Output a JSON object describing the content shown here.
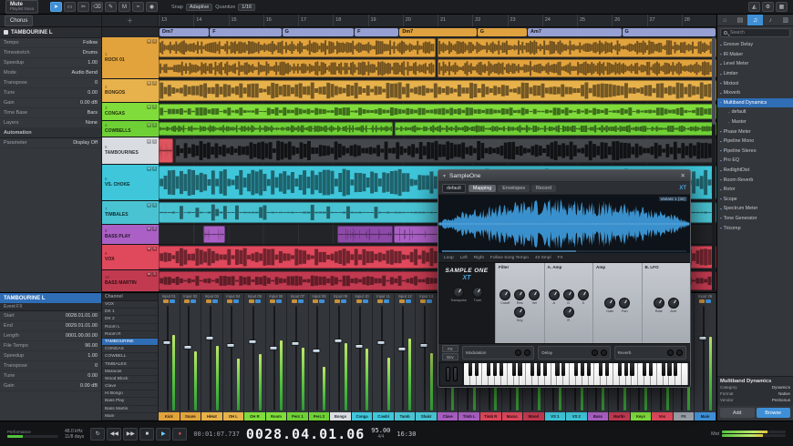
{
  "topbar": {
    "mute": "Mute",
    "playlist": "Playlist Nova",
    "tools": [
      {
        "n": "arrow-tool",
        "g": "➤"
      },
      {
        "n": "range-tool",
        "g": "▭"
      },
      {
        "n": "split-tool",
        "g": "✂"
      },
      {
        "n": "erase-tool",
        "g": "⌫"
      },
      {
        "n": "paint-tool",
        "g": "✎"
      },
      {
        "n": "mute-tool",
        "g": "M"
      },
      {
        "n": "bend-tool",
        "g": "≈"
      },
      {
        "n": "listen-tool",
        "g": "◉"
      }
    ],
    "snap_label": "Snap",
    "snap_mode": "Adaptive",
    "quantize_label": "Quantize",
    "quantize_value": "1/16",
    "right_icons": [
      {
        "n": "metronome-icon",
        "g": "◭"
      },
      {
        "n": "settings-icon",
        "g": "⚙"
      },
      {
        "n": "grid-icon",
        "g": "▦"
      }
    ]
  },
  "arrangetab": {
    "label": "Chorus"
  },
  "ruler": {
    "start": 13,
    "count": 16
  },
  "chords": [
    {
      "label": "Dm7",
      "w": 9,
      "c": "#97a0d2"
    },
    {
      "label": "F",
      "w": 13,
      "c": "#97a0d2"
    },
    {
      "label": "G",
      "w": 13,
      "c": "#97a0d2"
    },
    {
      "label": "F",
      "w": 8,
      "c": "#97a0d2"
    },
    {
      "label": "Dm7",
      "w": 14,
      "c": "#dfa23f"
    },
    {
      "label": "G",
      "w": 9,
      "c": "#dfa23f"
    },
    {
      "label": "Am7",
      "w": 17,
      "c": "#97a0d2"
    },
    {
      "label": "G",
      "w": 17,
      "c": "#97a0d2"
    }
  ],
  "tracks": [
    {
      "num": "1",
      "name": "ROCK 01",
      "color": "#e2a33c",
      "h": 46,
      "lanes": [
        [
          {
            "x": 0,
            "w": 49.6,
            "wave": "dense"
          },
          {
            "x": 50,
            "w": 50,
            "wave": "dense"
          }
        ],
        [
          {
            "x": 0,
            "w": 49.6,
            "wave": "dense"
          },
          {
            "x": 50,
            "w": 50,
            "wave": "dense"
          }
        ]
      ]
    },
    {
      "num": "2",
      "name": "BONGOS",
      "color": "#e7b14b",
      "h": 26,
      "lanes": [
        [
          {
            "x": 0,
            "w": 100,
            "wave": "dense"
          }
        ]
      ]
    },
    {
      "num": "3",
      "name": "CONGAS",
      "color": "#7fdc3a",
      "h": 20,
      "lanes": [
        [
          {
            "x": 0,
            "w": 100,
            "wave": "med"
          }
        ]
      ]
    },
    {
      "num": "4",
      "name": "COWBELLS",
      "color": "#6fd036",
      "h": 18,
      "lanes": [
        [
          {
            "x": 0,
            "w": 42,
            "wave": "med"
          },
          {
            "x": 42.4,
            "w": 57.6,
            "wave": "med"
          }
        ]
      ]
    },
    {
      "num": "5",
      "name": "TAMBOURINES",
      "color": "#d9dde2",
      "h": 30,
      "lanes": [
        [
          {
            "x": 0,
            "w": 2.6,
            "wave": "sparse",
            "color": "#e05560"
          },
          {
            "x": 2.9,
            "w": 97.1,
            "wave": "dense",
            "color": "#44474b",
            "stroke": "rgba(8,10,12,0.85)"
          }
        ]
      ]
    },
    {
      "num": "6",
      "name": "VS. CHOKE",
      "color": "#3fc6da",
      "h": 40,
      "lanes": [
        [
          {
            "x": 0,
            "w": 100,
            "wave": "dense"
          }
        ]
      ]
    },
    {
      "num": "7",
      "name": "TIMBALES",
      "color": "#49c3d2",
      "h": 26,
      "lanes": [
        [
          {
            "x": 0,
            "w": 100,
            "wave": "sparse"
          }
        ]
      ]
    },
    {
      "num": "8",
      "name": "BASS PLAY",
      "color": "#aa60c4",
      "h": 22,
      "lanes": [
        [
          {
            "x": 8,
            "w": 4,
            "wave": "sparse"
          },
          {
            "x": 32,
            "w": 10,
            "wave": "sparse",
            "color": "#8e4aa8"
          },
          {
            "x": 42.2,
            "w": 13,
            "wave": "sparse"
          },
          {
            "x": 55.5,
            "w": 2.6,
            "wave": "sparse"
          }
        ]
      ]
    },
    {
      "num": "9",
      "name": "VOX",
      "color": "#e0485c",
      "h": 28,
      "lanes": [
        [
          {
            "x": 0,
            "w": 100,
            "wave": "dense"
          }
        ]
      ]
    },
    {
      "num": "10",
      "name": "BASS MARTIN",
      "color": "#c23a50",
      "h": 24,
      "lanes": [
        [
          {
            "x": 0,
            "w": 100,
            "wave": "med"
          }
        ]
      ]
    }
  ],
  "inspector": {
    "title": "TAMBOURINE L",
    "rows": [
      [
        "Tempo",
        "Follow"
      ],
      [
        "Timestretch",
        "Drums"
      ],
      [
        "Speedup",
        "1.00"
      ],
      [
        "Mode",
        "Audio Bend"
      ],
      [
        "Transpose",
        "0"
      ],
      [
        "Tune",
        "0.00"
      ],
      [
        "Gain",
        "0.00 dB"
      ],
      [
        "Time Base",
        "Bars"
      ],
      [
        "Layers",
        "None"
      ]
    ],
    "automation_label": "Automation",
    "auto_rows": [
      [
        "Parameter",
        "Display Off"
      ]
    ]
  },
  "eventpanel": {
    "title": "TAMBOURINE L",
    "subtitle": "Event FX",
    "rows": [
      [
        "Start",
        "0028.01.01.00"
      ],
      [
        "End",
        "0029.01.01.00"
      ],
      [
        "Length",
        "0001.00.00.00"
      ],
      [
        "File Tempo",
        "96.00"
      ],
      [
        "Speedup",
        "1.00"
      ],
      [
        "Transpose",
        "0"
      ],
      [
        "Tune",
        "0.00"
      ],
      [
        "Gain",
        "0.00 dB"
      ]
    ]
  },
  "mixer": {
    "channel_header": "Channel",
    "left_list": [
      "VOX",
      "DK 1",
      "DK 2",
      "Room L",
      "Room R",
      "TAMBOURINE",
      "CONGAS",
      "COWBELL",
      "TIMBALES",
      "Maracas",
      "Wood Block",
      "Clave",
      "Hi Bongo",
      "Bass Play",
      "Bass Martin",
      "Main"
    ],
    "highlight": "TAMBOURINE",
    "strips": [
      {
        "label": "Input 01",
        "level": 62,
        "meter": 70,
        "tag": "Kick",
        "color": "#e2a33c"
      },
      {
        "label": "Input 02",
        "level": 58,
        "meter": 55,
        "tag": "Snare",
        "color": "#e2a33c"
      },
      {
        "label": "Input 03",
        "level": 66,
        "meter": 60,
        "tag": "HiHat",
        "color": "#e7b14b"
      },
      {
        "label": "Input 04",
        "level": 60,
        "meter": 48,
        "tag": "OH L",
        "color": "#e7b14b"
      },
      {
        "label": "Input 05",
        "level": 63,
        "meter": 52,
        "tag": "OH R",
        "color": "#7fdc3a"
      },
      {
        "label": "Input 06",
        "level": 57,
        "meter": 65,
        "tag": "Room",
        "color": "#7fdc3a"
      },
      {
        "label": "Input 07",
        "level": 61,
        "meter": 58,
        "tag": "Perc 1",
        "color": "#6fd036"
      },
      {
        "label": "Input 08",
        "level": 55,
        "meter": 40,
        "tag": "Perc 2",
        "color": "#6fd036"
      },
      {
        "label": "Input 09",
        "level": 64,
        "meter": 62,
        "tag": "Bongo",
        "color": "#d9dde2"
      },
      {
        "label": "Input 10",
        "level": 59,
        "meter": 57,
        "tag": "Conga",
        "color": "#3fc6da"
      },
      {
        "label": "Input 11",
        "level": 62,
        "meter": 49,
        "tag": "Cowbl",
        "color": "#3fc6da"
      },
      {
        "label": "Input 12",
        "level": 56,
        "meter": 66,
        "tag": "Tamb",
        "color": "#49c3d2"
      },
      {
        "label": "Input 13",
        "level": 60,
        "meter": 53,
        "tag": "Shakr",
        "color": "#49c3d2"
      },
      {
        "label": "Input 14",
        "level": 65,
        "meter": 58,
        "tag": "Clave",
        "color": "#aa60c4"
      },
      {
        "label": "Input 15",
        "level": 58,
        "meter": 45,
        "tag": "Timb L",
        "color": "#aa60c4"
      },
      {
        "label": "Input 16",
        "level": 61,
        "meter": 60,
        "tag": "Timb R",
        "color": "#e0485c"
      },
      {
        "label": "Input 17",
        "level": 57,
        "meter": 52,
        "tag": "Marac",
        "color": "#e0485c"
      },
      {
        "label": "Input 18",
        "level": 63,
        "meter": 63,
        "tag": "Wood",
        "color": "#c23a50"
      },
      {
        "label": "Input 19",
        "level": 59,
        "meter": 47,
        "tag": "VS 1",
        "color": "#3fc6da"
      },
      {
        "label": "Input 20",
        "level": 62,
        "meter": 58,
        "tag": "VS 2",
        "color": "#3fc6da"
      },
      {
        "label": "Input 21",
        "level": 60,
        "meter": 66,
        "tag": "Bass",
        "color": "#aa60c4"
      },
      {
        "label": "Input 22",
        "level": 64,
        "meter": 50,
        "tag": "Martin",
        "color": "#c23a50"
      },
      {
        "label": "Input 23",
        "level": 58,
        "meter": 56,
        "tag": "Keys",
        "color": "#7fdc3a"
      },
      {
        "label": "Input 24",
        "level": 61,
        "meter": 61,
        "tag": "Vox",
        "color": "#e0485c"
      },
      {
        "label": "Input 25",
        "level": 55,
        "meter": 44,
        "tag": "FX",
        "color": "#9aa0a7"
      },
      {
        "label": "Input 26",
        "level": 66,
        "meter": 68,
        "tag": "Main",
        "color": "#3f8fd6"
      }
    ]
  },
  "browser": {
    "tabs": [
      {
        "n": "home-tab",
        "g": "⌂"
      },
      {
        "n": "instruments-tab",
        "g": "▤"
      },
      {
        "n": "effects-tab",
        "g": "♫",
        "active": true
      },
      {
        "n": "loops-tab",
        "g": "♪"
      },
      {
        "n": "files-tab",
        "g": "▥"
      }
    ],
    "search_placeholder": "Search",
    "items": [
      {
        "label": "Groove Delay"
      },
      {
        "label": "IR Maker"
      },
      {
        "label": "Level Meter"
      },
      {
        "label": "Limiter"
      },
      {
        "label": "Mixtool"
      },
      {
        "label": "Mixverb"
      },
      {
        "label": "Multiband Dynamics",
        "selected": true
      },
      {
        "label": "default",
        "child": true
      },
      {
        "label": "Master",
        "child": true
      },
      {
        "label": "Phase Meter"
      },
      {
        "label": "Pipeline Mono"
      },
      {
        "label": "Pipeline Stereo"
      },
      {
        "label": "Pro EQ"
      },
      {
        "label": "RedlightDist"
      },
      {
        "label": "Room Reverb"
      },
      {
        "label": "Rotor"
      },
      {
        "label": "Scope"
      },
      {
        "label": "Spectrum Meter"
      },
      {
        "label": "Tone Generator"
      },
      {
        "label": "Tricomp"
      }
    ],
    "info_title": "Multiband Dynamics",
    "info_lines": [
      [
        "Category",
        "Dynamics"
      ],
      [
        "Format",
        "Native"
      ],
      [
        "Vendor",
        "PreSonus"
      ]
    ],
    "buttons": [
      {
        "label": "Add",
        "primary": false
      },
      {
        "label": "Browse",
        "primary": true
      }
    ]
  },
  "plugin": {
    "title": "SampleOne",
    "tabs": [
      "Mapping",
      "Envelopes",
      "Record"
    ],
    "active_tab": "Mapping",
    "preset": "default",
    "sample_label": "Variant 1 (32)",
    "strip_labels": [
      "Loop",
      "Left",
      "Right",
      "Follow Song Tempo",
      "43 Smpl",
      "FX"
    ],
    "logo1": "SAMPLE ONE",
    "logo2": "XT",
    "left_knobs": [
      "Transpose",
      "Tune"
    ],
    "sections": [
      {
        "title": "Filter",
        "knobs": [
          "Cutoff",
          "Res",
          "Vel",
          "Key"
        ]
      },
      {
        "title": "A. Amp",
        "knobs": [
          "A",
          "D",
          "S",
          "R"
        ]
      },
      {
        "title": "Amp",
        "knobs": [
          "Gain",
          "Pan"
        ]
      },
      {
        "title": "B. LFO",
        "knobs": [
          "Rate",
          "Amt"
        ]
      }
    ],
    "bottom_sections": [
      "Modulation",
      "Delay",
      "Reverb"
    ],
    "left_buttons": [
      "FX",
      "Env"
    ]
  },
  "transport": {
    "performance_label": "Performance",
    "sample_rate": "48.0 kHz",
    "record_space": "11/8 days",
    "timecode": "00:01:07.737",
    "position": "0028.04.01.06",
    "tempo": "95.00",
    "sig": "4/4",
    "clock": "16:30",
    "buttons": [
      {
        "n": "loop-button",
        "g": "↻"
      },
      {
        "n": "rewind-button",
        "g": "◀◀"
      },
      {
        "n": "forward-button",
        "g": "▶▶"
      },
      {
        "n": "stop-button",
        "g": "■"
      },
      {
        "n": "play-button",
        "g": "▶",
        "cls": "play"
      },
      {
        "n": "record-button",
        "g": "●",
        "cls": "rec"
      }
    ],
    "master_label": "Mst"
  }
}
